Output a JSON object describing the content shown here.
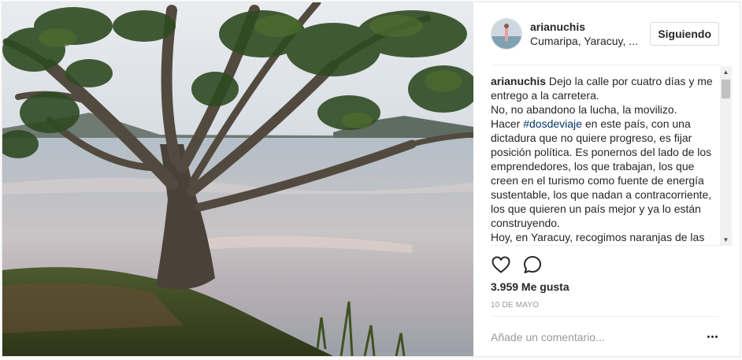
{
  "photo": {
    "alt_name": "lakeside-tree-photo"
  },
  "header": {
    "username": "arianuchis",
    "location": "Cumaripa, Yaracuy, ...",
    "follow_label": "Siguiendo"
  },
  "caption": {
    "username": "arianuchis",
    "line1": "Dejo la calle por cuatro días y me entrego a la carretera.",
    "line2": "No, no abandono la lucha, la movilizo.",
    "line3_before": "Hacer ",
    "hashtag": "#dosdeviaje",
    "line3_after": " en este país, con una dictadura que no quiere progreso, es fijar posición política. Es ponernos del lado de los emprendedores, los que trabajan, los que creen en el turismo como fuente de energía sustentable, los que nadan a contracorriente, los que quieren un país mejor y ya lo están construyendo.",
    "line4": "Hoy, en Yaracuy, recogimos naranjas de las"
  },
  "actions": {
    "like_icon": "heart-icon",
    "comment_icon": "comment-bubble-icon"
  },
  "likes": "3.959 Me gusta",
  "date": "10 DE MAYO",
  "comment": {
    "placeholder": "Añade un comentario...",
    "more_icon": "more-options-icon"
  },
  "colors": {
    "hashtag": "#003569",
    "text": "#262626",
    "muted": "#999999",
    "border": "#efefef"
  }
}
